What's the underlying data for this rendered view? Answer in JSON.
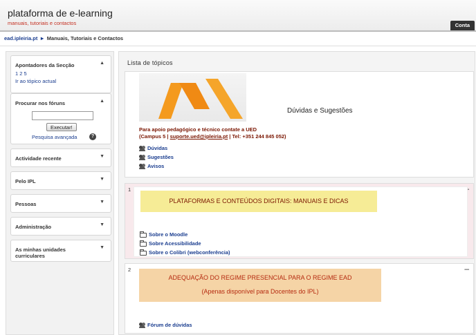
{
  "header": {
    "site_title": "plataforma de e-learning",
    "site_subtitle": "manuais, tutoriais e contactos",
    "account_label": "Conta"
  },
  "breadcrumb": {
    "home": "ead.ipleiria.pt",
    "separator": "►",
    "current": "Manuais, Tutoriais e Contactos"
  },
  "sidebar": {
    "sections_block": {
      "title": "Apontadores da Secção",
      "links": [
        "1",
        "2",
        "5"
      ],
      "current_topic_link": "Ir ao tópico actual",
      "toggle_icon": "chevron-up-icon"
    },
    "forum_search": {
      "title": "Procurar nos fóruns",
      "search_value": "",
      "button": "Executar!",
      "advanced_link": "Pesquisa avançada",
      "help_icon": "help-icon",
      "toggle_icon": "chevron-up-icon"
    },
    "collapsed_blocks": [
      "Actividade recente",
      "Pelo IPL",
      "Pessoas",
      "Administração",
      "As minhas unidades curriculares"
    ]
  },
  "main": {
    "title": "Lista de tópicos",
    "intro": {
      "brand_title": "Dúvidas e Sugestões",
      "contact_line1": "Para apoio pedagógico e técnico contate a UED",
      "contact_line2_prefix": "(Campus 5",
      "contact_email": "suporte.ued@ipleiria.pt",
      "contact_phone": "Tel: +351 244 845 052)",
      "links": [
        "Dúvidas",
        "Sugestões",
        "Avisos"
      ]
    },
    "topics": [
      {
        "number": "1",
        "heading": "PLATAFORMAS E CONTEÚDOS DIGITAIS: MANUAIS E DICAS",
        "links": [
          "Sobre o Moodle",
          "Sobre Acessibilidade",
          "Sobre o Colibri (webconferência)"
        ]
      },
      {
        "number": "2",
        "heading": "ADEQUAÇÃO DO REGIME PRESENCIAL PARA O REGIME EAD",
        "subheading": "(Apenas disponível para Docentes do IPL)",
        "links": [
          "Fórum de dúvidas"
        ]
      }
    ],
    "collapse_icon": "minus-icon"
  },
  "colors": {
    "accent_orange": "#f49a1e",
    "subtitle_red": "#c42f20",
    "link_blue": "#1a3d8f",
    "topic_yellow": "#f6ec96",
    "topic_tan": "#f5d4a6",
    "dark_red_text": "#7a1500"
  }
}
